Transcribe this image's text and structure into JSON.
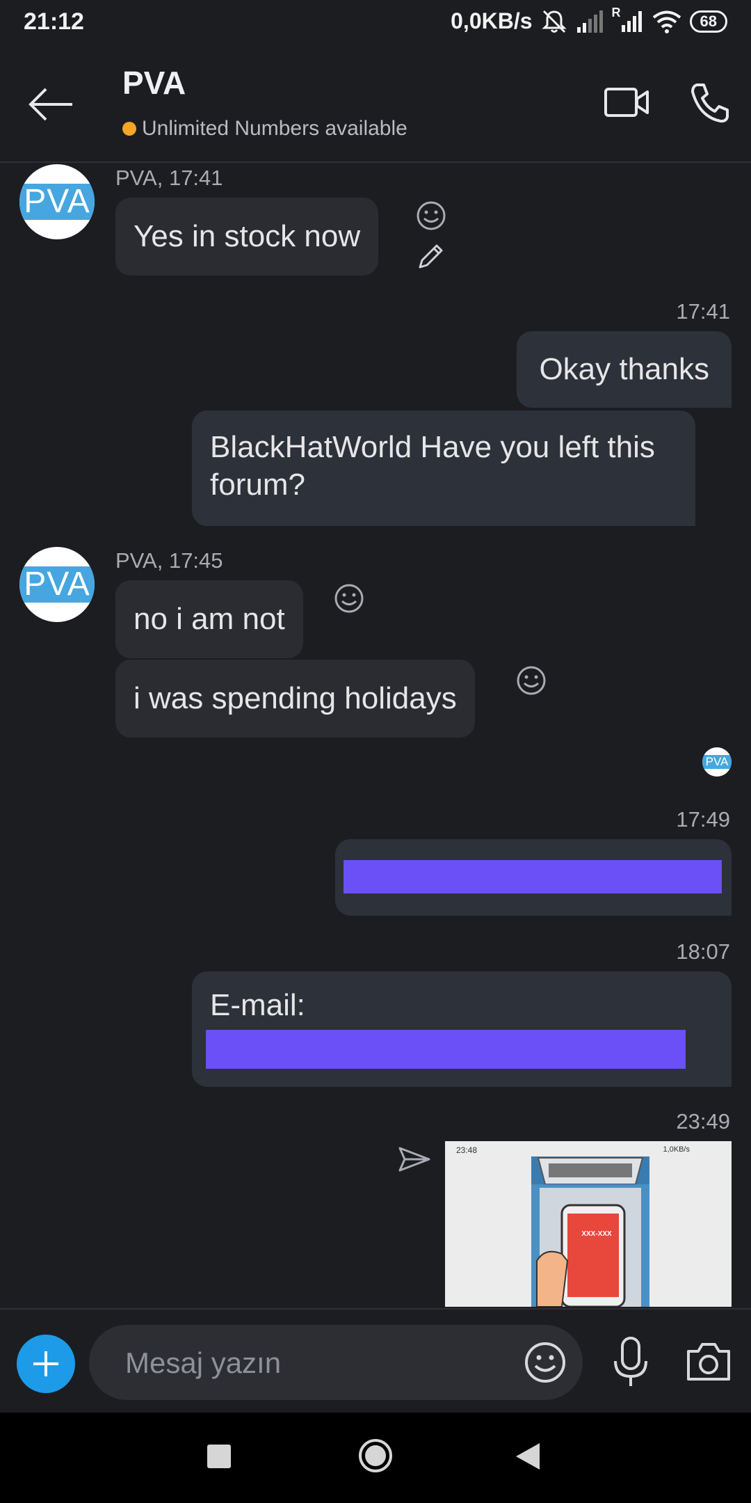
{
  "status_bar": {
    "time": "21:12",
    "network_speed": "0,0KB/s",
    "battery": "68",
    "roaming_label": "R"
  },
  "header": {
    "contact_name": "PVA",
    "contact_status": "Unlimited Numbers available"
  },
  "avatar_text": "PVA",
  "messages": {
    "m1": {
      "sender": "PVA, 17:41",
      "text": "Yes in stock now"
    },
    "m2": {
      "time": "17:41",
      "text": "Okay thanks"
    },
    "m3": {
      "text": "BlackHatWorld Have you left this forum?"
    },
    "m4": {
      "sender": "PVA, 17:45",
      "text": "no i am not"
    },
    "m5": {
      "text": "i was spending holidays"
    },
    "m6": {
      "time": "17:49"
    },
    "m7": {
      "time": "18:07",
      "text": "E-mail:"
    },
    "m8": {
      "time": "23:49",
      "thumb_time": "23:48",
      "thumb_status": "1,0KB/s",
      "thumb_code": "XXX-XXX"
    }
  },
  "composer": {
    "placeholder": "Mesaj yazın"
  },
  "colors": {
    "background": "#1c1d21",
    "incoming_bubble": "#2a2c31",
    "outgoing_bubble": "#2d3139",
    "accent": "#1d9be8",
    "status_dot": "#f5a623",
    "redaction": "#6a50f6"
  },
  "icons": [
    "back-arrow-icon",
    "video-camera-icon",
    "phone-icon",
    "smiley-icon",
    "pencil-icon",
    "send-icon",
    "plus-icon",
    "microphone-icon",
    "camera-icon",
    "mute-icon",
    "signal-icon",
    "wifi-icon",
    "battery-icon",
    "stop-icon",
    "home-icon",
    "back-triangle-icon"
  ]
}
